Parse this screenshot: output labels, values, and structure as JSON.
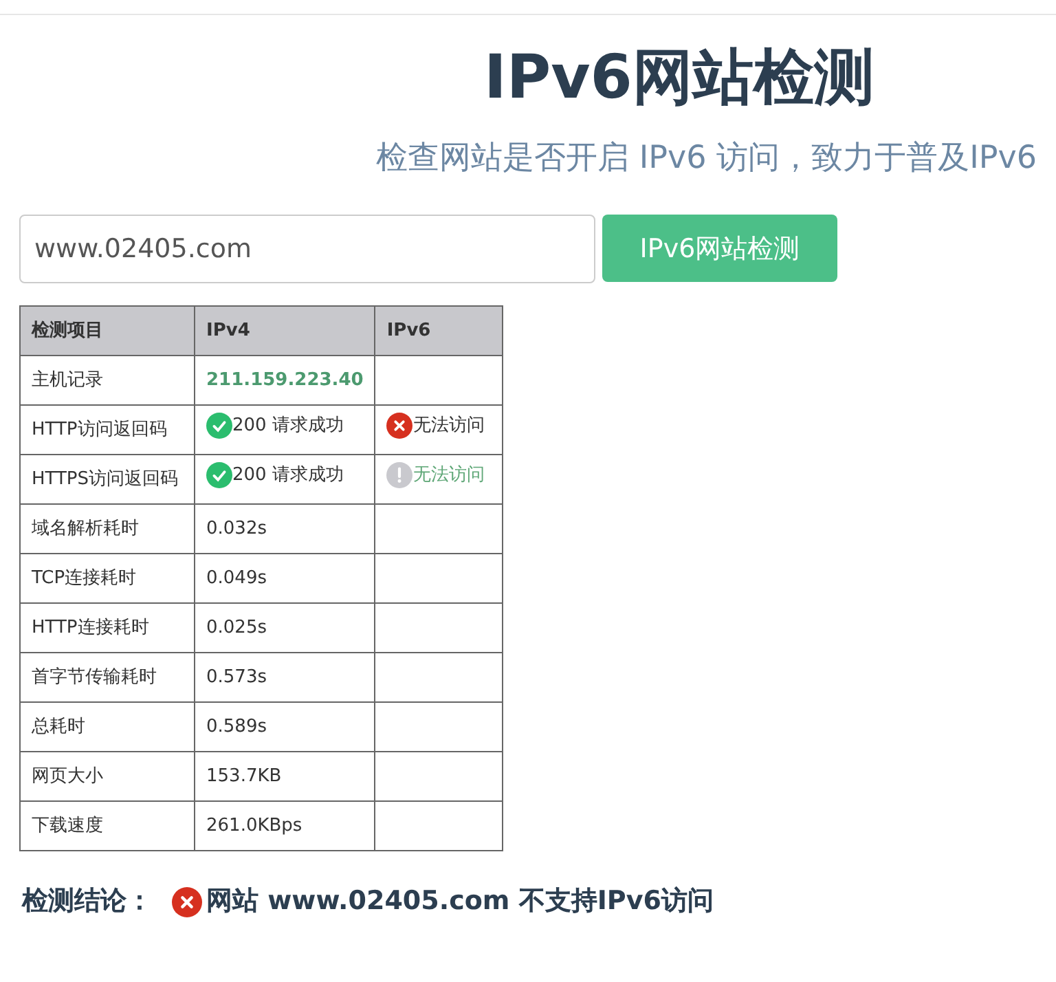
{
  "title": "IPv6网站检测",
  "subtitle": "检查网站是否开启 IPv6 访问，致力于普及IPv6",
  "search": {
    "value": "www.02405.com",
    "button": "IPv6网站检测"
  },
  "table": {
    "columns": [
      "检测项目",
      "IPv4",
      "IPv6"
    ],
    "rows": [
      [
        {
          "text": "主机记录"
        },
        {
          "text": "211.159.223.40",
          "kind": "address"
        },
        {
          "text": ""
        }
      ],
      [
        {
          "text": "HTTP访问返回码"
        },
        {
          "text": "200 请求成功",
          "kind": "ok"
        },
        {
          "text": "无法访问",
          "kind": "error"
        }
      ],
      [
        {
          "text": "HTTPS访问返回码"
        },
        {
          "text": "200 请求成功",
          "kind": "ok"
        },
        {
          "text": "无法访问",
          "kind": "warning"
        }
      ],
      [
        {
          "text": "域名解析耗时"
        },
        {
          "text": "0.032s"
        },
        {
          "text": ""
        }
      ],
      [
        {
          "text": "TCP连接耗时"
        },
        {
          "text": "0.049s"
        },
        {
          "text": ""
        }
      ],
      [
        {
          "text": "HTTP连接耗时"
        },
        {
          "text": "0.025s"
        },
        {
          "text": ""
        }
      ],
      [
        {
          "text": "首字节传输耗时"
        },
        {
          "text": "0.573s"
        },
        {
          "text": ""
        }
      ],
      [
        {
          "text": "总耗时"
        },
        {
          "text": "0.589s"
        },
        {
          "text": ""
        }
      ],
      [
        {
          "text": "网页大小"
        },
        {
          "text": "153.7KB"
        },
        {
          "text": ""
        }
      ],
      [
        {
          "text": "下载速度"
        },
        {
          "text": "261.0KBps"
        },
        {
          "text": ""
        }
      ]
    ]
  },
  "conclusion": {
    "label": "检测结论：",
    "kind": "error",
    "text": "网站 www.02405.com 不支持IPv6访问"
  }
}
